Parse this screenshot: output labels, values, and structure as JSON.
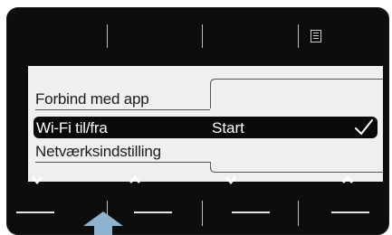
{
  "menu": {
    "items": [
      {
        "label": "Forbind med app",
        "value": "",
        "selected": false
      },
      {
        "label": "Wi-Fi til/fra",
        "value": "Start",
        "selected": true
      },
      {
        "label": "Netværksindstilling",
        "value": "",
        "selected": false
      }
    ]
  },
  "softkeys": {
    "top_right_icon": "list-icon",
    "bottom": [
      "chevron-down-icon",
      "chevron-up-icon",
      "chevron-down-icon",
      "chevron-up-icon"
    ]
  },
  "indicator": {
    "icon": "up-arrow-pointer-icon",
    "color": "#8fb3cf"
  },
  "colors": {
    "bezel": "#0d0d0d",
    "screen": "#efefef",
    "selection": "#0a0a0a"
  }
}
